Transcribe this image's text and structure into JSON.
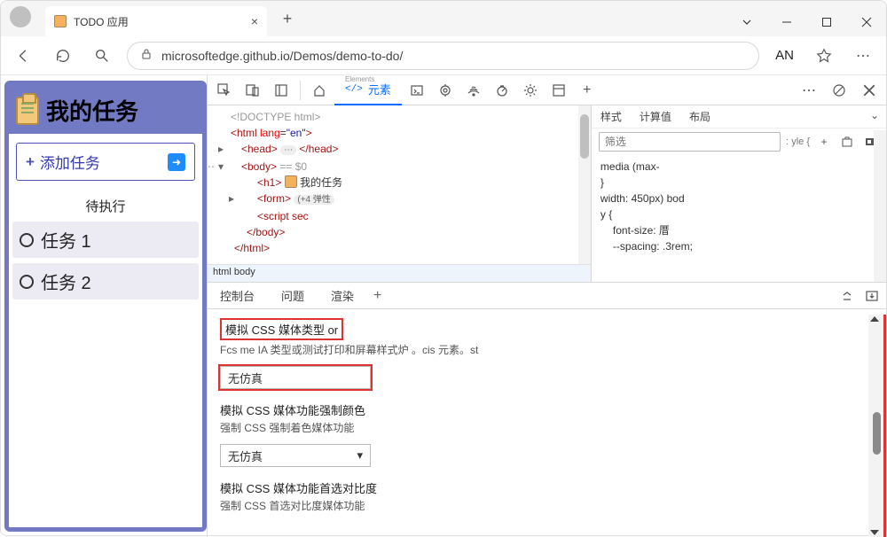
{
  "window": {
    "tab_title": "TODO 应用",
    "url": "microsoftedge.github.io/Demos/demo-to-do/",
    "profile_label": "AN"
  },
  "todo": {
    "title": "我的任务",
    "add_label": "添加任务",
    "section": "待执行",
    "tasks": [
      "任务 1",
      "任务 2"
    ]
  },
  "devtools": {
    "elements_tab": "元素",
    "elements_ruby": "Elements",
    "dom": {
      "doctype": "<!DOCTYPE html>",
      "html_open": "<html lang=\"en\">",
      "head_open": "<head>",
      "head_badge": "⋯",
      "head_close": "</head>",
      "body_open": "<body>",
      "body_suffix": "== $0",
      "h1_open": "<h1>",
      "h1_text": "我的任务",
      "form_open": "<form>",
      "form_badge": "(+4 弹性",
      "script": "<script sec",
      "body_close": "</body>",
      "html_close": "</html>",
      "breadcrumb": "html  body"
    },
    "styles": {
      "tab_styles": "样式",
      "tab_computed": "计算值",
      "tab_layout": "布局",
      "filter_placeholder": "筛选",
      "hint": ": yle {",
      "body": {
        "l1": "media (max-",
        "l2": "}",
        "l3": "width: 450px) bod",
        "l4": "y {",
        "link": "to-do-styles.css:40",
        "l5": "font-size:         厝",
        "l6": "--spacing:  .3rem;"
      }
    },
    "drawer": {
      "tab_console": "控制台",
      "tab_issues": "问题",
      "tab_rendering": "渲染",
      "rendering": {
        "media_type_label": "模拟 CSS 媒体类型 or",
        "media_type_desc": "Fcs me IA 类型或测试打印和屏幕样式炉 。cis 元素。st",
        "no_emulation": "无仿真",
        "color_label": "模拟 CSS 媒体功能强制颜色",
        "color_desc": "强制 CSS 强制着色媒体功能",
        "contrast_label": "模拟 CSS 媒体功能首选对比度",
        "contrast_desc": "强制 CSS 首选对比度媒体功能"
      }
    }
  }
}
